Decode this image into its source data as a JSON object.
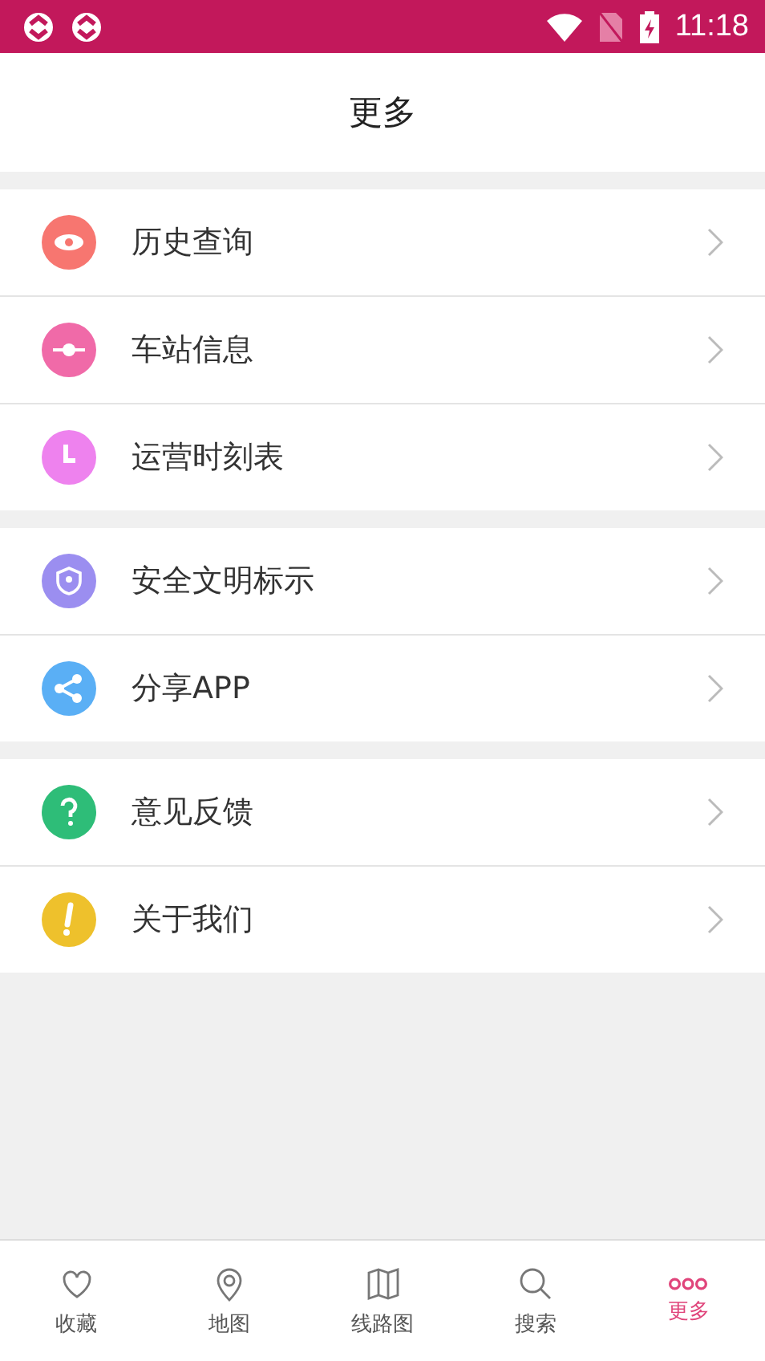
{
  "status_bar": {
    "time": "11:18"
  },
  "header": {
    "title": "更多"
  },
  "groups": [
    {
      "items": [
        {
          "label": "历史查询",
          "color": "#f77670"
        },
        {
          "label": "车站信息",
          "color": "#f06aa8"
        },
        {
          "label": "运营时刻表",
          "color": "#ee82ee"
        }
      ]
    },
    {
      "items": [
        {
          "label": "安全文明标示",
          "color": "#9b8ef0"
        },
        {
          "label": "分享APP",
          "color": "#5aaff5"
        }
      ]
    },
    {
      "items": [
        {
          "label": "意见反馈",
          "color": "#2ebd78"
        },
        {
          "label": "关于我们",
          "color": "#eec12c"
        }
      ]
    }
  ],
  "tab_bar": [
    {
      "label": "收藏",
      "selected": false
    },
    {
      "label": "地图",
      "selected": false
    },
    {
      "label": "线路图",
      "selected": false
    },
    {
      "label": "搜索",
      "selected": false
    },
    {
      "label": "更多",
      "selected": true
    }
  ]
}
